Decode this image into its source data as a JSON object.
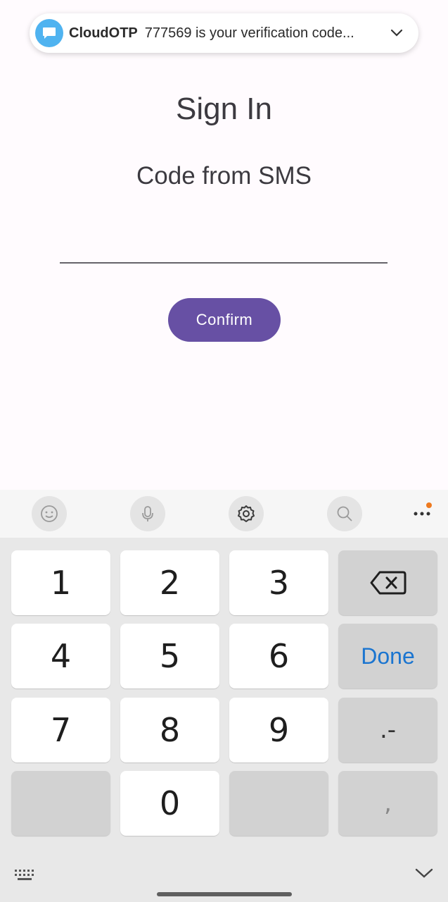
{
  "notification": {
    "app": "CloudOTP",
    "message": "777569 is your verification code..."
  },
  "screen": {
    "title": "Sign In",
    "subtitle": "Code from SMS",
    "code_value": "",
    "confirm_label": "Confirm"
  },
  "keyboard": {
    "toolbar": [
      "emoji-icon",
      "microphone-icon",
      "settings-icon",
      "search-icon",
      "more-icon"
    ],
    "keys": {
      "k1": "1",
      "k2": "2",
      "k3": "3",
      "k4": "4",
      "k5": "5",
      "k6": "6",
      "k7": "7",
      "k8": "8",
      "k9": "9",
      "k0": "0",
      "done": "Done",
      "dot_dash": ".-",
      "comma": ","
    }
  },
  "colors": {
    "accent": "#6750a4",
    "notif_icon": "#4fb3f0",
    "done_text": "#1b75d0",
    "badge": "#ee7a1f"
  }
}
